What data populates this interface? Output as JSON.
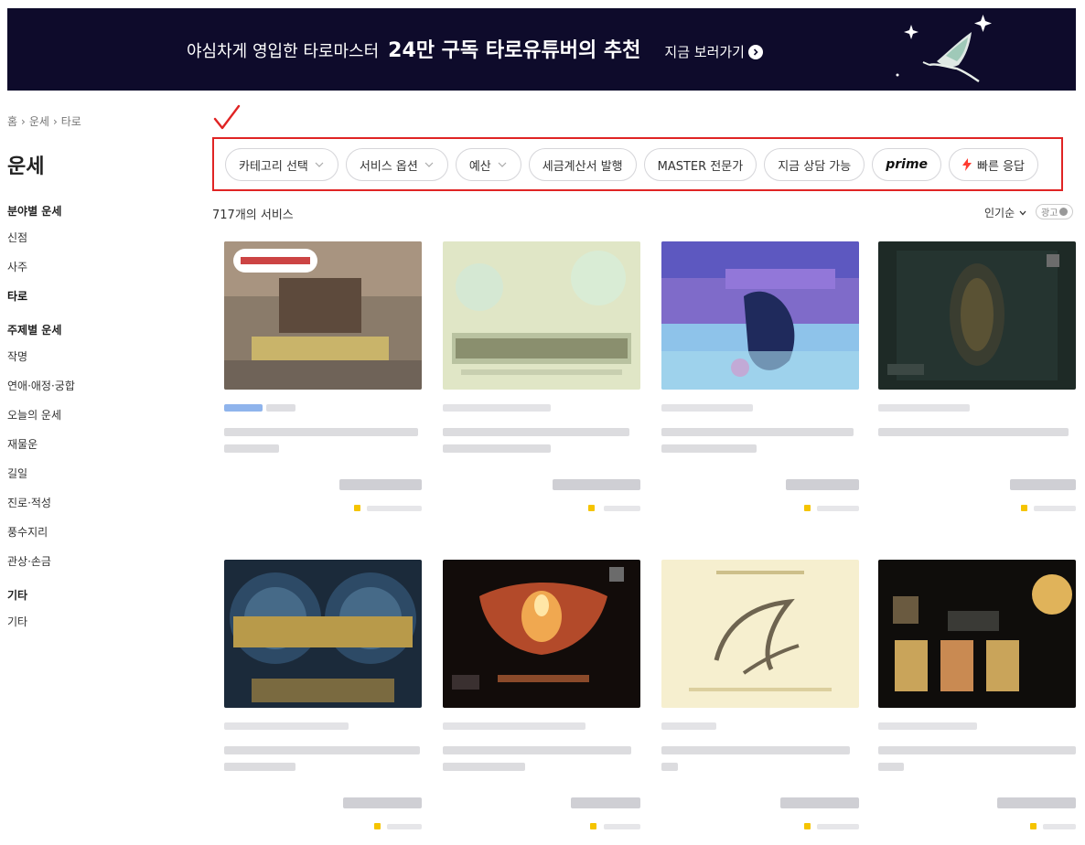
{
  "banner": {
    "lead": "야심차게 영입한 타로마스터",
    "highlight": "24만 구독 타로유튜버의 추천",
    "cta": "지금 보러가기"
  },
  "breadcrumb": [
    "홈",
    "운세",
    "타로"
  ],
  "page_title": "운세",
  "sidebar": {
    "groups": [
      {
        "title": "분야별 운세",
        "items": [
          "신점",
          "사주",
          "타로"
        ]
      },
      {
        "title": "주제별 운세",
        "items": [
          "작명",
          "연애·애정·궁합",
          "오늘의 운세",
          "재물운",
          "길일",
          "진로·적성",
          "풍수지리",
          "관상·손금"
        ]
      },
      {
        "title": "기타",
        "items": [
          "기타"
        ]
      }
    ],
    "active_item": "타로"
  },
  "filters": [
    {
      "label": "카테고리 선택",
      "dropdown": true
    },
    {
      "label": "서비스 옵션",
      "dropdown": true
    },
    {
      "label": "예산",
      "dropdown": true
    },
    {
      "label": "세금계산서 발행",
      "dropdown": false
    },
    {
      "label": "MASTER 전문가",
      "dropdown": false
    },
    {
      "label": "지금 상담 가능",
      "dropdown": false
    },
    {
      "label": "prime",
      "dropdown": false
    },
    {
      "label": "빠른 응답",
      "dropdown": false
    }
  ],
  "result_count": "717개의 서비스",
  "sort_label": "인기순",
  "ad_label": "광고",
  "colors": {
    "banner_bg": "#0e0b2b",
    "annotation_red": "#e02424",
    "rating_star": "#f5c400"
  }
}
